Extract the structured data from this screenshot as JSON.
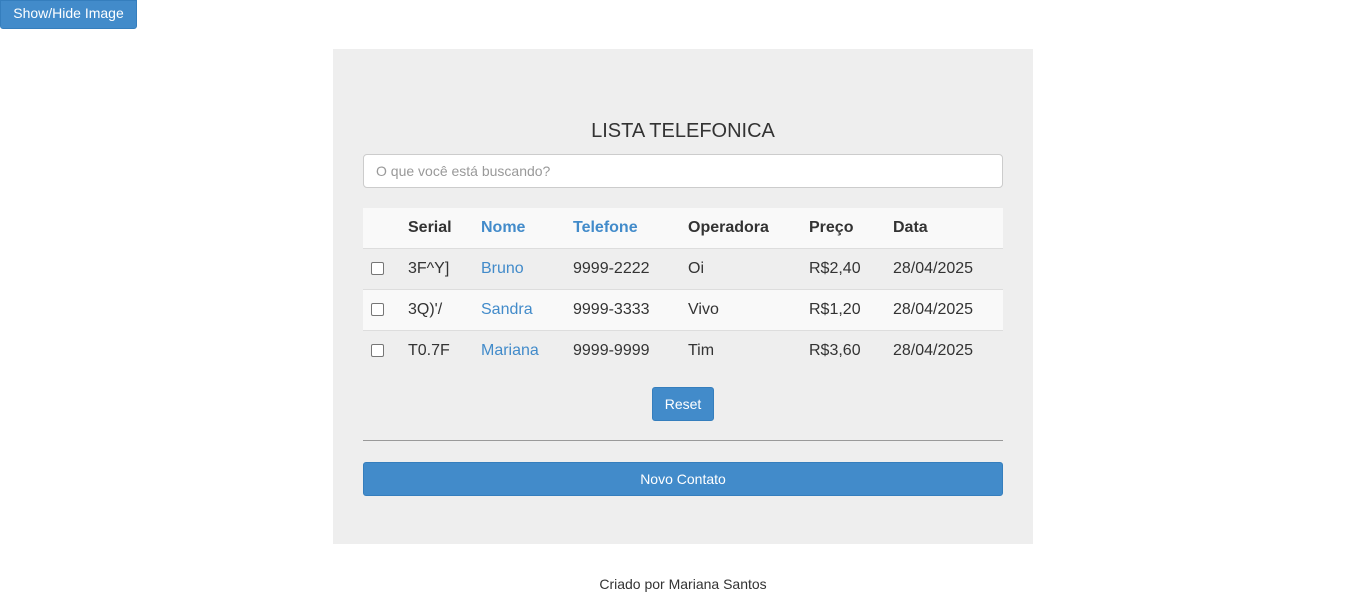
{
  "toggle_button": {
    "label": "Show/Hide Image"
  },
  "panel": {
    "title": "LISTA TELEFONICA",
    "search": {
      "placeholder": "O que você está buscando?",
      "value": ""
    },
    "table": {
      "columns": [
        "Serial",
        "Nome",
        "Telefone",
        "Operadora",
        "Preço",
        "Data"
      ],
      "rows": [
        {
          "serial": "3F^Y]",
          "nome": "Bruno",
          "telefone": "9999-2222",
          "operadora": "Oi",
          "preco": "R$2,40",
          "data": "28/04/2025",
          "checked": false
        },
        {
          "serial": "3Q)'/",
          "nome": "Sandra",
          "telefone": "9999-3333",
          "operadora": "Vivo",
          "preco": "R$1,20",
          "data": "28/04/2025",
          "checked": false
        },
        {
          "serial": "T0.7F",
          "nome": "Mariana",
          "telefone": "9999-9999",
          "operadora": "Tim",
          "preco": "R$3,60",
          "data": "28/04/2025",
          "checked": false
        }
      ]
    },
    "reset_label": "Reset",
    "new_contact_label": "Novo Contato"
  },
  "footer": {
    "text": "Criado por Mariana Santos"
  },
  "colors": {
    "accent": "#428bca",
    "panel_bg": "#eeeeee",
    "text": "#333333"
  }
}
